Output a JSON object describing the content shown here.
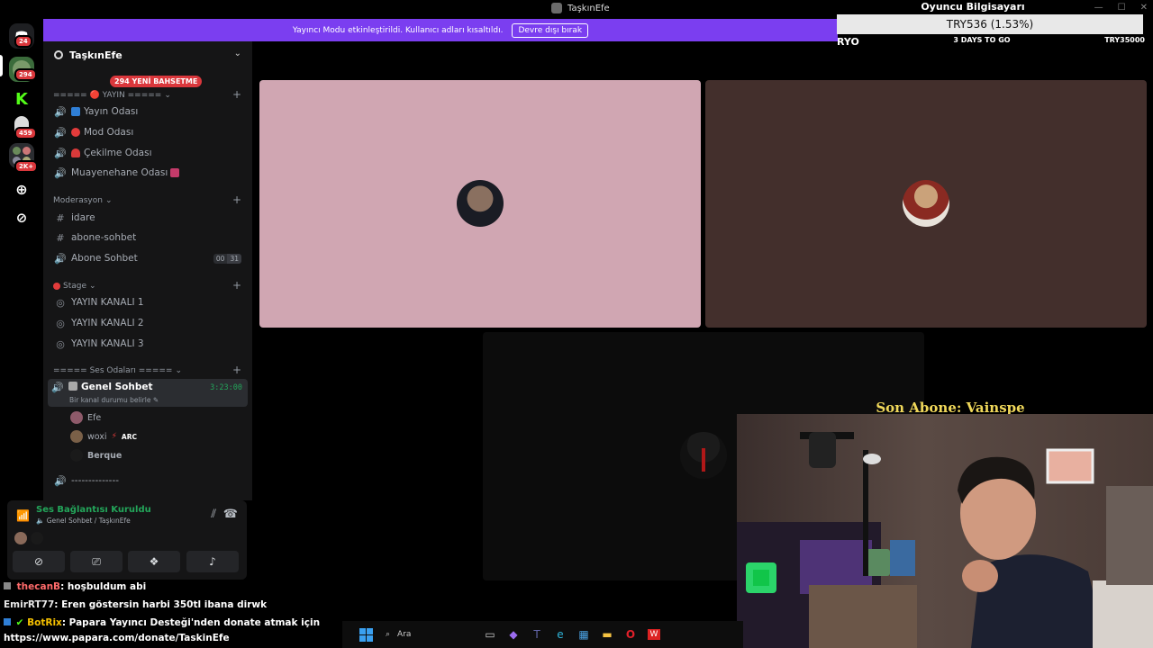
{
  "window": {
    "title": "TaşkınEfe"
  },
  "rail": {
    "servers": [
      {
        "name": "discord-home",
        "badge": "24"
      },
      {
        "name": "server-1",
        "badge": "294"
      },
      {
        "name": "kick",
        "badge": ""
      },
      {
        "name": "server-3",
        "badge": "459"
      },
      {
        "name": "server-folder",
        "badge": "2K+"
      }
    ]
  },
  "banner": {
    "text": "Yayıncı Modu etkinleştirildi. Kullanıcı adları kısaltıldı.",
    "button": "Devre dışı bırak"
  },
  "overlay": {
    "title": "Oyuncu Bilgisayarı",
    "value": "TRY536 (1.53%)",
    "left": "RYO",
    "middle": "3 DAYS TO GO",
    "right": "TRY35000"
  },
  "sidebar": {
    "guild_name": "TaşkınEfe",
    "mention_pill": "294 YENİ BAHSETME",
    "categories": {
      "yayin": "===== 🔴 YAYIN =====",
      "moderasyon": "Moderasyon",
      "stage": "Stage",
      "ses": "===== Ses Odaları ====="
    },
    "channels": {
      "yayin_odasi": "Yayın Odası",
      "mod_odasi": "Mod Odası",
      "cekilme_odasi": "Çekilme Odası",
      "muayenehane": "Muayenehane Odası",
      "idare": "idare",
      "abone_sohbet_text": "abone-sohbet",
      "abone_sohbet_voice": "Abone Sohbet",
      "abone_count_a": "00",
      "abone_count_b": "31",
      "yayin_kanali_1": "YAYIN KANALI 1",
      "yayin_kanali_2": "YAYIN KANALI 2",
      "yayin_kanali_3": "YAYIN KANALI 3",
      "genel_sohbet": "Genel Sohbet",
      "genel_timer": "3:23:00",
      "genel_status": "Bir kanal durumu belirle",
      "dashes": "--------------"
    },
    "voice_users": [
      {
        "name": "Efe",
        "tag": ""
      },
      {
        "name": "woxi",
        "tag": "ARC"
      },
      {
        "name": "Berque",
        "tag": ""
      }
    ]
  },
  "voice_panel": {
    "status": "Ses Bağlantısı Kuruldu",
    "sub": "Genel Sohbet / TaşkınEfe"
  },
  "stream_overlay": {
    "son_abone": "Son Abone: Vainspe"
  },
  "chat": [
    {
      "user": "thecanB",
      "msg": ": hoşbuldum abi"
    },
    {
      "user": "EmirRT77",
      "msg": ": Eren göstersin harbi 350tl ibana dirwk"
    },
    {
      "user": "BotRix",
      "msg": ": Papara Yayıncı Desteği'nden donate atmak için"
    },
    {
      "user": "",
      "msg": "https://www.papara.com/donate/TaskinEfe"
    }
  ],
  "taskbar": {
    "search_placeholder": "Ara"
  },
  "colors": {
    "accent": "#7b3ef0",
    "tile1": "#d0a6b2",
    "tile2": "#432f2c",
    "tile3": "#0c0c0c",
    "online": "#23a55a",
    "badge": "#da373c"
  }
}
